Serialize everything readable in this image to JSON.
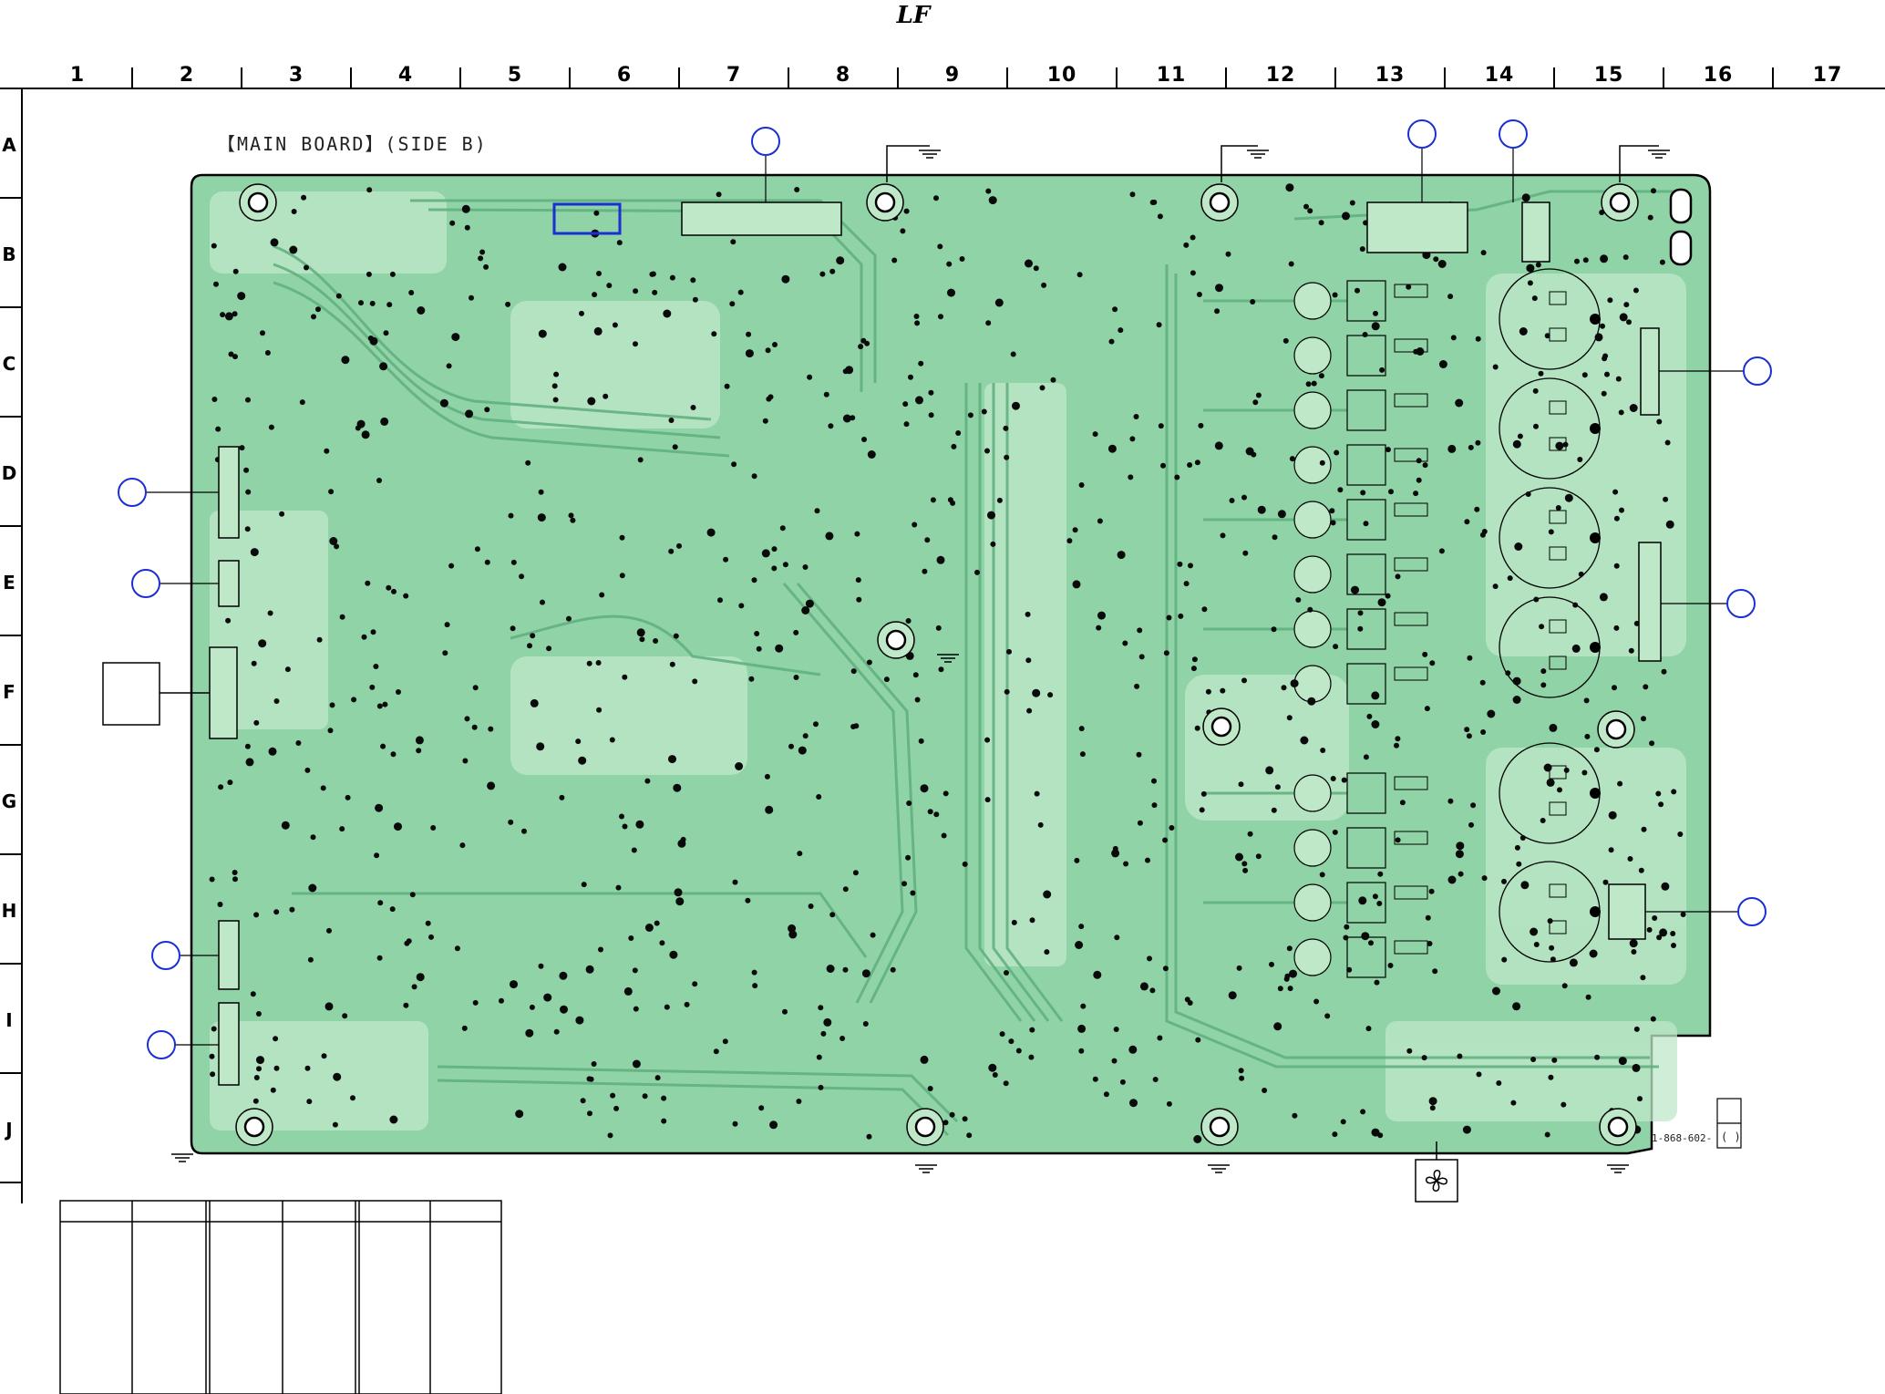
{
  "logo_text": "LF",
  "board_title": "【MAIN BOARD】(SIDE B)",
  "part_number": "1-868-602-",
  "part_suffix": "( )",
  "grid": {
    "columns": [
      "1",
      "2",
      "3",
      "4",
      "5",
      "6",
      "7",
      "8",
      "9",
      "10",
      "11",
      "12",
      "13",
      "14",
      "15",
      "16",
      "17"
    ],
    "rows": [
      "A",
      "B",
      "C",
      "D",
      "E",
      "F",
      "G",
      "H",
      "I",
      "J"
    ]
  },
  "colors": {
    "board_fill": "#8fd3a6",
    "copper_light": "#bfe8c9",
    "trace_dark": "#5fae7d",
    "pad_black": "#0a0a0a",
    "outline": "#000000",
    "callout_blue": "#1a2fd6"
  }
}
